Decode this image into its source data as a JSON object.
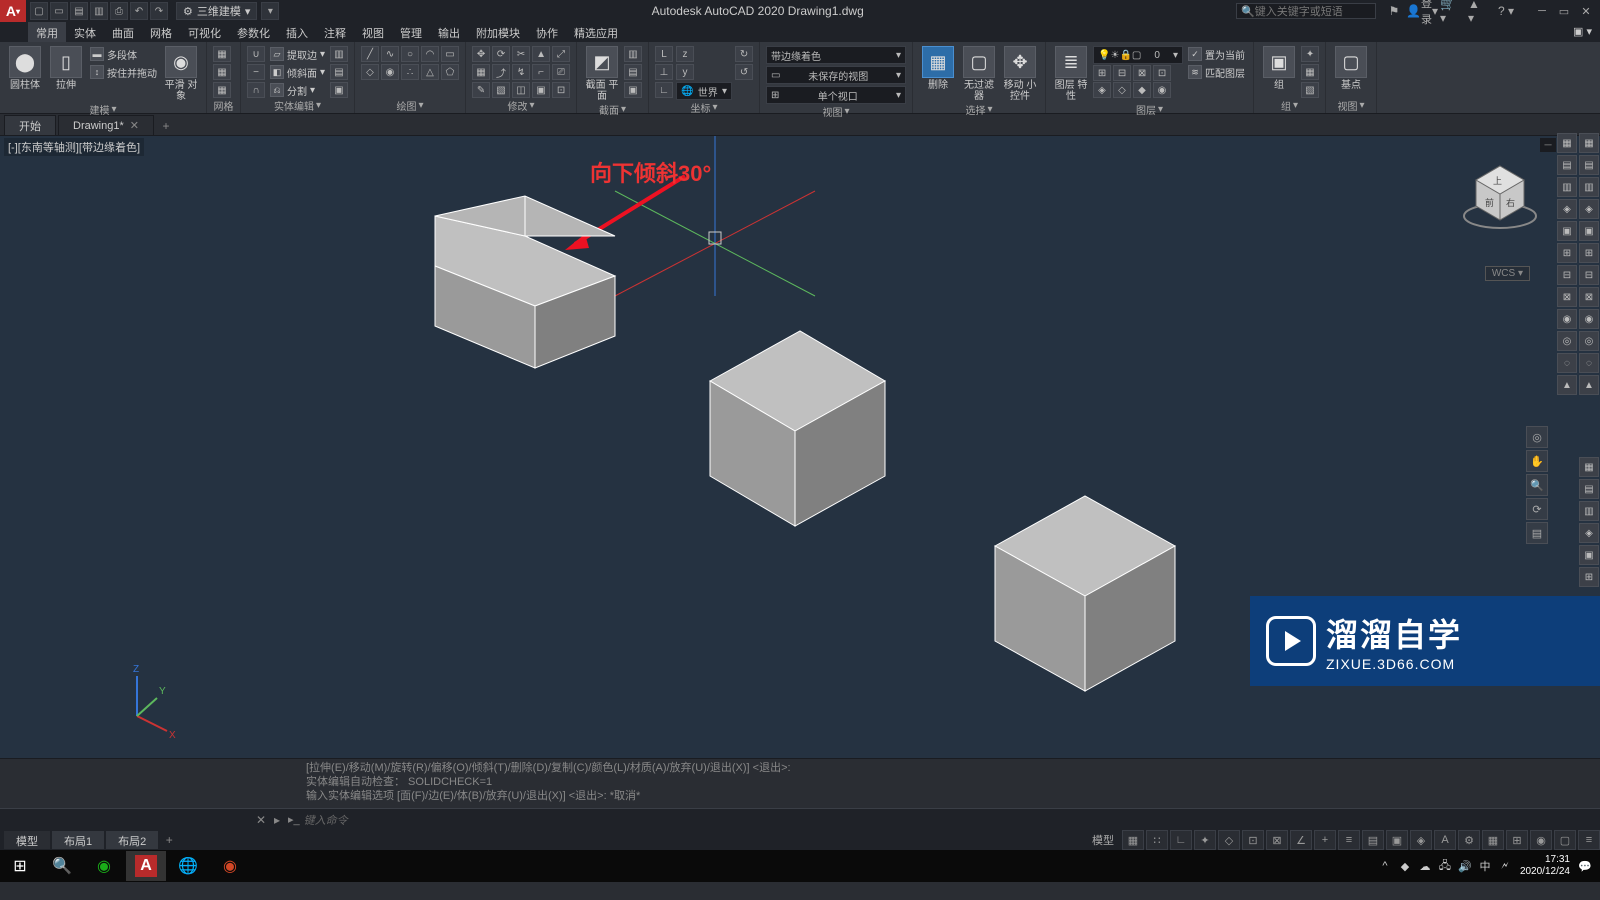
{
  "app": {
    "logo_letter": "A",
    "title": "Autodesk AutoCAD 2020   Drawing1.dwg"
  },
  "qat": {
    "workspace": "三维建模"
  },
  "title_right": {
    "search_placeholder": "键入关键字或短语",
    "login": "登录"
  },
  "menus": [
    "常用",
    "实体",
    "曲面",
    "网格",
    "可视化",
    "参数化",
    "插入",
    "注释",
    "视图",
    "管理",
    "输出",
    "附加模块",
    "协作",
    "精选应用"
  ],
  "ribbon": {
    "panel_model": {
      "title": "建模",
      "cylinder": "圆柱体",
      "extrude": "拉伸",
      "poly": "多段体",
      "pushpull": "按住并拖动",
      "smooth": "平滑\n对象",
      "meshlbl": "网格"
    },
    "panel_solidedit": {
      "title": "实体编辑",
      "extract": "提取边",
      "incline": "倾斜面",
      "sep": "分割"
    },
    "panel_draw": {
      "title": "绘图"
    },
    "panel_modify": {
      "title": "修改"
    },
    "panel_section": {
      "title": "截面",
      "plane": "截面\n平面"
    },
    "panel_coord": {
      "title": "坐标",
      "world": "世界"
    },
    "panel_view": {
      "title": "视图",
      "style": "带边缘着色",
      "saved": "未保存的视图",
      "single": "单个视口"
    },
    "panel_select": {
      "title": "选择",
      "erase": "删除",
      "nofilter": "无过滤器",
      "move": "移动\n小控件"
    },
    "panel_layer": {
      "title": "图层",
      "props": "图层\n特性",
      "layer0": "0",
      "current": "置为当前",
      "match": "匹配图层"
    },
    "panel_group": {
      "title": "组",
      "group": "组"
    },
    "panel_viewpanel": {
      "title": "视图",
      "base": "基点"
    }
  },
  "file_tabs": {
    "start": "开始",
    "drawing": "Drawing1*"
  },
  "viewport": {
    "label": "[-][东南等轴测][带边缘着色]",
    "wcs": "WCS"
  },
  "annotation": {
    "text": "向下倾斜30°"
  },
  "cmd": {
    "h1": "[拉伸(E)/移动(M)/旋转(R)/偏移(O)/倾斜(T)/删除(D)/复制(C)/颜色(L)/材质(A)/放弃(U)/退出(X)] <退出>:",
    "h2": "实体编辑自动检查： SOLIDCHECK=1",
    "h3": "输入实体编辑选项 [面(F)/边(E)/体(B)/放弃(U)/退出(X)] <退出>: *取消*",
    "prompt": "键入命令"
  },
  "model_tabs": {
    "model": "模型",
    "layout1": "布局1",
    "layout2": "布局2"
  },
  "status": {
    "model": "模型"
  },
  "watermark": {
    "t1": "溜溜自学",
    "t2": "ZIXUE.3D66.COM"
  },
  "taskbar": {
    "time": "17:31",
    "date": "2020/12/24"
  },
  "axes": {
    "x": "X",
    "y": "Y",
    "z": "Z"
  }
}
